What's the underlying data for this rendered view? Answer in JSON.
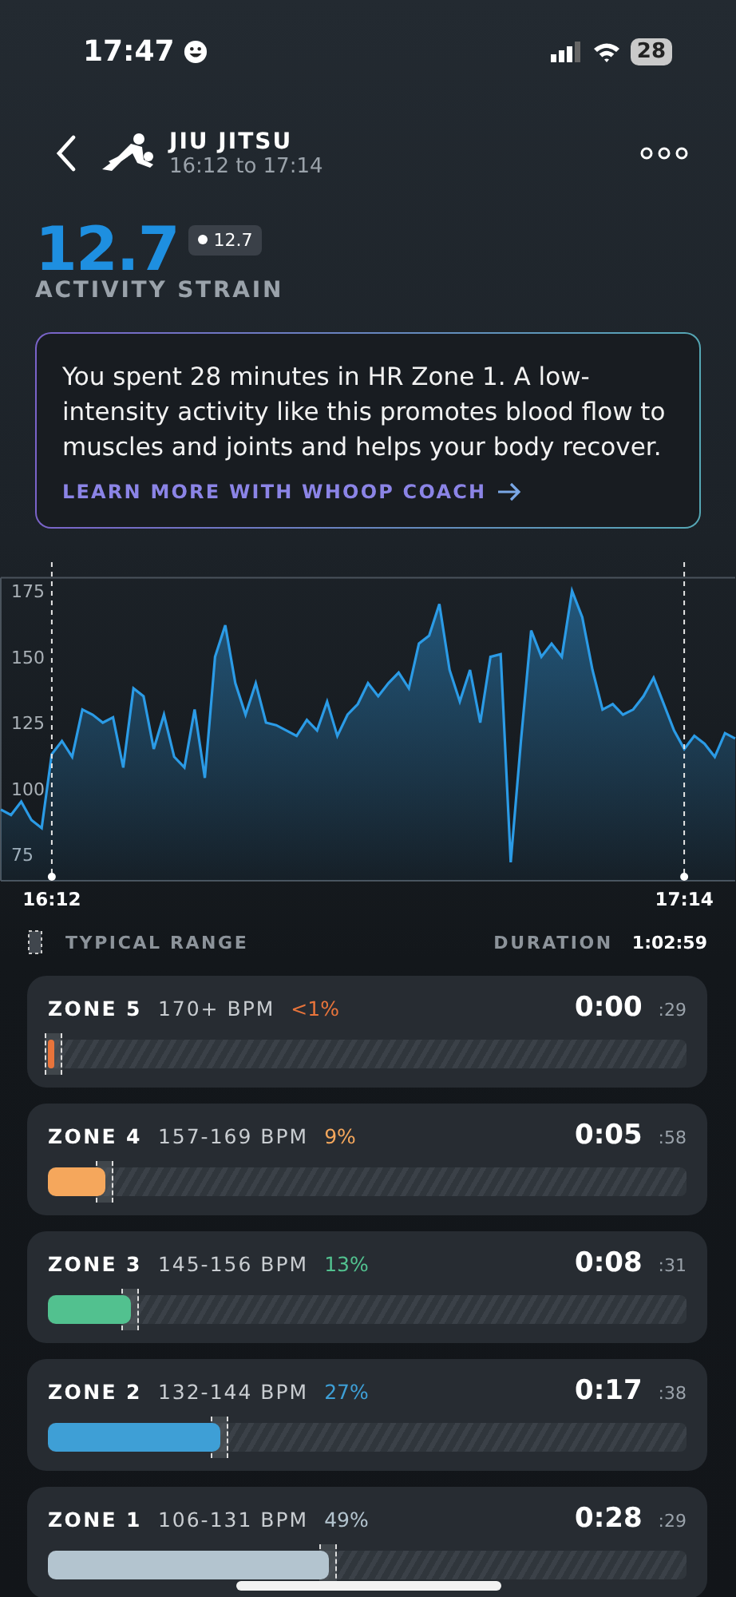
{
  "status_bar": {
    "time": "17:47",
    "battery": "28"
  },
  "header": {
    "title": "JIU JITSU",
    "subtitle": "16:12 to 17:14"
  },
  "strain": {
    "value": "12.7",
    "badge": "12.7",
    "label": "ACTIVITY STRAIN"
  },
  "coach_card": {
    "text": "You spent 28 minutes in HR Zone 1. A low-intensity activity like this promotes blood flow to muscles and joints and helps your body recover.",
    "link": "LEARN MORE WITH WHOOP COACH"
  },
  "heart_rate_chart": {
    "chart_data": {
      "type": "area",
      "x": [
        967,
        968,
        969,
        970,
        971,
        972,
        973,
        974,
        975,
        976,
        977,
        978,
        979,
        980,
        981,
        982,
        983,
        984,
        985,
        986,
        987,
        988,
        989,
        990,
        991,
        992,
        993,
        994,
        995,
        996,
        997,
        998,
        999,
        1000,
        1001,
        1002,
        1003,
        1004,
        1005,
        1006,
        1007,
        1008,
        1009,
        1010,
        1011,
        1012,
        1013,
        1014,
        1015,
        1016,
        1017,
        1018,
        1019,
        1020,
        1021,
        1022,
        1023,
        1024,
        1025,
        1026,
        1027,
        1028,
        1029,
        1030,
        1031,
        1032,
        1033,
        1034,
        1035,
        1036,
        1037,
        1038,
        1039
      ],
      "series": [
        {
          "color": "#2b9be6",
          "values": [
            92,
            90,
            95,
            88,
            85,
            113,
            118,
            112,
            130,
            128,
            125,
            127,
            108,
            138,
            135,
            115,
            128,
            112,
            108,
            130,
            104,
            150,
            162,
            140,
            128,
            140,
            125,
            124,
            122,
            120,
            126,
            122,
            133,
            120,
            128,
            132,
            140,
            135,
            140,
            144,
            138,
            155,
            158,
            170,
            145,
            133,
            145,
            125,
            150,
            151,
            72,
            118,
            160,
            150,
            155,
            150,
            175,
            165,
            145,
            130,
            132,
            128,
            130,
            135,
            142,
            132,
            122,
            115,
            120,
            117,
            112,
            121,
            119
          ]
        }
      ],
      "xlim": [
        967,
        1039
      ],
      "ylim": [
        65,
        180
      ],
      "yticks": [
        75,
        100,
        125,
        150,
        175
      ],
      "xticks": [
        {
          "value": 972,
          "label": "16:12"
        },
        {
          "value": 1034,
          "label": "17:14"
        }
      ]
    }
  },
  "legend": {
    "typical_range": "TYPICAL RANGE",
    "duration_label": "DURATION",
    "duration": "1:02:59"
  },
  "zones": [
    {
      "name": "ZONE 5",
      "bpm": "170+ BPM",
      "percent": "<1%",
      "color": "#e8743b",
      "time": "0:00",
      "seconds": ":29",
      "level": 0.01
    },
    {
      "name": "ZONE 4",
      "bpm": "157-169 BPM",
      "percent": "9%",
      "color": "#f5a75c",
      "time": "0:05",
      "seconds": ":58",
      "level": 0.09
    },
    {
      "name": "ZONE 3",
      "bpm": "145-156 BPM",
      "percent": "13%",
      "color": "#52c18f",
      "time": "0:08",
      "seconds": ":31",
      "level": 0.13
    },
    {
      "name": "ZONE 2",
      "bpm": "132-144 BPM",
      "percent": "27%",
      "color": "#3e9fd6",
      "time": "0:17",
      "seconds": ":38",
      "level": 0.27
    },
    {
      "name": "ZONE 1",
      "bpm": "106-131 BPM",
      "percent": "49%",
      "color": "#b3c4cf",
      "time": "0:28",
      "seconds": ":29",
      "level": 0.44
    }
  ]
}
